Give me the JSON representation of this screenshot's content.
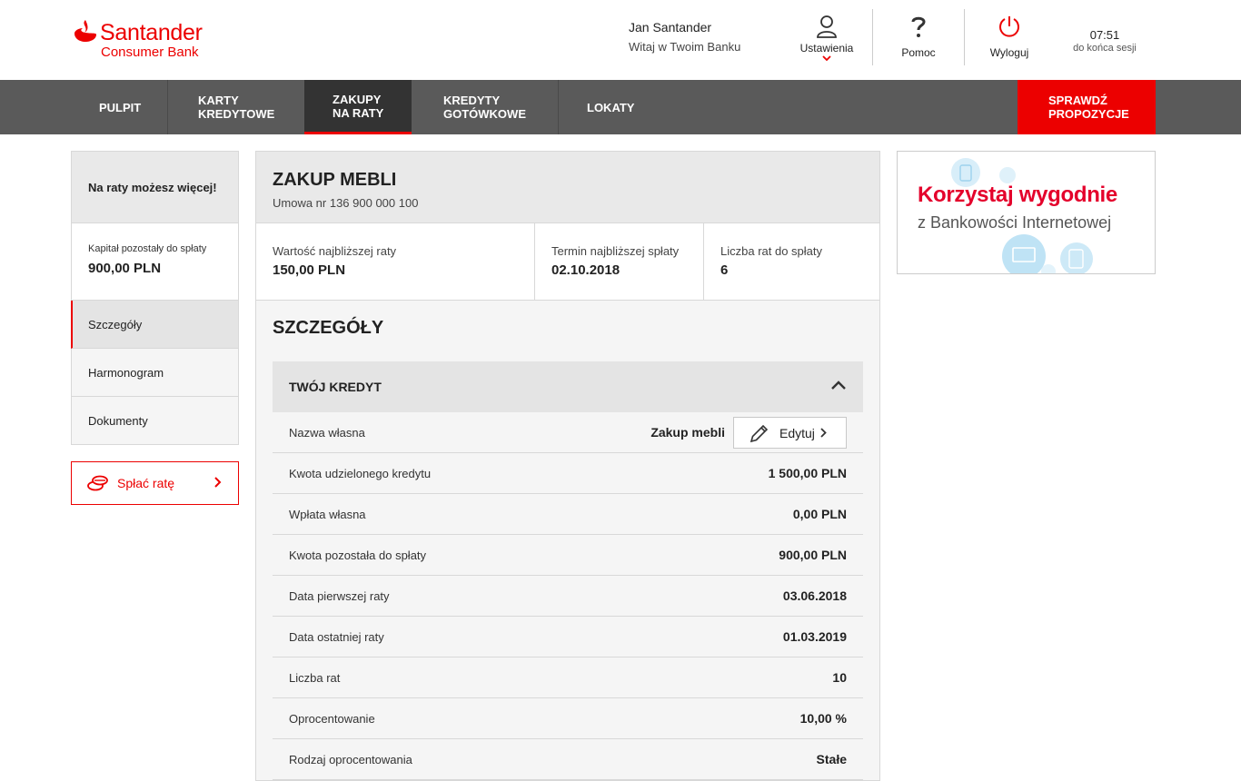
{
  "brand": {
    "name": "Santander",
    "sub": "Consumer Bank",
    "color": "#ec0000"
  },
  "user": {
    "name": "Jan Santander",
    "greeting": "Witaj w Twoim Banku"
  },
  "header_actions": [
    {
      "icon": "user-icon",
      "label": "Ustawienia"
    },
    {
      "icon": "question-icon",
      "label": "Pomoc"
    },
    {
      "icon": "power-icon",
      "label": "Wyloguj"
    }
  ],
  "session": {
    "time": "07:51",
    "text": "do końca sesji"
  },
  "nav": {
    "items": [
      {
        "line1": "PULPIT",
        "line2": ""
      },
      {
        "line1": "KARTY",
        "line2": "KREDYTOWE"
      },
      {
        "line1": "ZAKUPY",
        "line2": "NA RATY"
      },
      {
        "line1": "KREDYTY",
        "line2": "GOTÓWKOWE"
      },
      {
        "line1": "LOKATY",
        "line2": ""
      }
    ],
    "active_index": 2,
    "cta": {
      "line1": "SPRAWDŹ",
      "line2": "PROPOZYCJE"
    }
  },
  "sidebar": {
    "title": "Na raty możesz więcej!",
    "capital_label": "Kapitał pozostały do spłaty",
    "capital_value": "900,00 PLN",
    "items": [
      "Szczegóły",
      "Harmonogram",
      "Dokumenty"
    ],
    "pay_button": "Spłać ratę"
  },
  "main": {
    "title": "ZAKUP MEBLI",
    "contract": "Umowa nr 136 900 000 100",
    "stats": [
      {
        "label": "Wartość najbliższej raty",
        "value": "150,00 PLN"
      },
      {
        "label": "Termin najbliższej spłaty",
        "value": "02.10.2018"
      },
      {
        "label": "Liczba rat do spłaty",
        "value": "6"
      }
    ],
    "section_title": "SZCZEGÓŁY",
    "accordion_title": "TWÓJ KREDYT",
    "edit_label": "Edytuj",
    "rows": [
      {
        "label": "Nazwa własna",
        "value": "Zakup mebli"
      },
      {
        "label": "Kwota udzielonego kredytu",
        "value": "1 500,00 PLN"
      },
      {
        "label": "Wpłata własna",
        "value": "0,00 PLN"
      },
      {
        "label": "Kwota pozostała do spłaty",
        "value": "900,00 PLN"
      },
      {
        "label": "Data pierwszej raty",
        "value": "03.06.2018"
      },
      {
        "label": "Data ostatniej raty",
        "value": "01.03.2019"
      },
      {
        "label": "Liczba rat",
        "value": "10"
      },
      {
        "label": "Oprocentowanie",
        "value": "10,00 %"
      },
      {
        "label": "Rodzaj oprocentowania",
        "value": "Stałe"
      }
    ]
  },
  "ad": {
    "headline": "Korzystaj wygodnie",
    "subline": "z Bankowości Internetowej"
  }
}
